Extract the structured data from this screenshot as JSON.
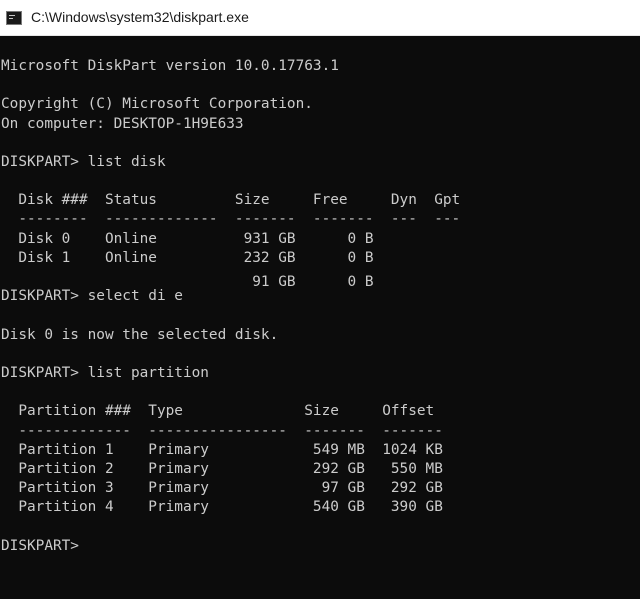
{
  "window": {
    "title": "C:\\Windows\\system32\\diskpart.exe",
    "icon": "console-icon"
  },
  "console": {
    "background": "#0c0c0c",
    "foreground": "#cccccc",
    "lines": [
      "Microsoft DiskPart version 10.0.17763.1",
      "",
      "Copyright (C) Microsoft Corporation.",
      "On computer: DESKTOP-1H9E633",
      "",
      "DISKPART> list disk",
      "",
      "  Disk ###  Status         Size     Free     Dyn  Gpt",
      "  --------  -------------  -------  -------  ---  ---",
      "  Disk 0    Online          931 GB      0 B",
      "  Disk 1    Online          232 GB      0 B",
      "                             91 GB      0 B",
      "DISKPART> select di e",
      "",
      "Disk 0 is now the selected disk.",
      "",
      "DISKPART> list partition",
      "",
      "  Partition ###  Type              Size     Offset",
      "  -------------  ----------------  -------  -------",
      "  Partition 1    Primary            549 MB  1024 KB",
      "  Partition 2    Primary            292 GB   550 MB",
      "  Partition 3    Primary             97 GB   292 GB",
      "  Partition 4    Primary            540 GB   390 GB",
      "",
      "DISKPART>"
    ]
  }
}
